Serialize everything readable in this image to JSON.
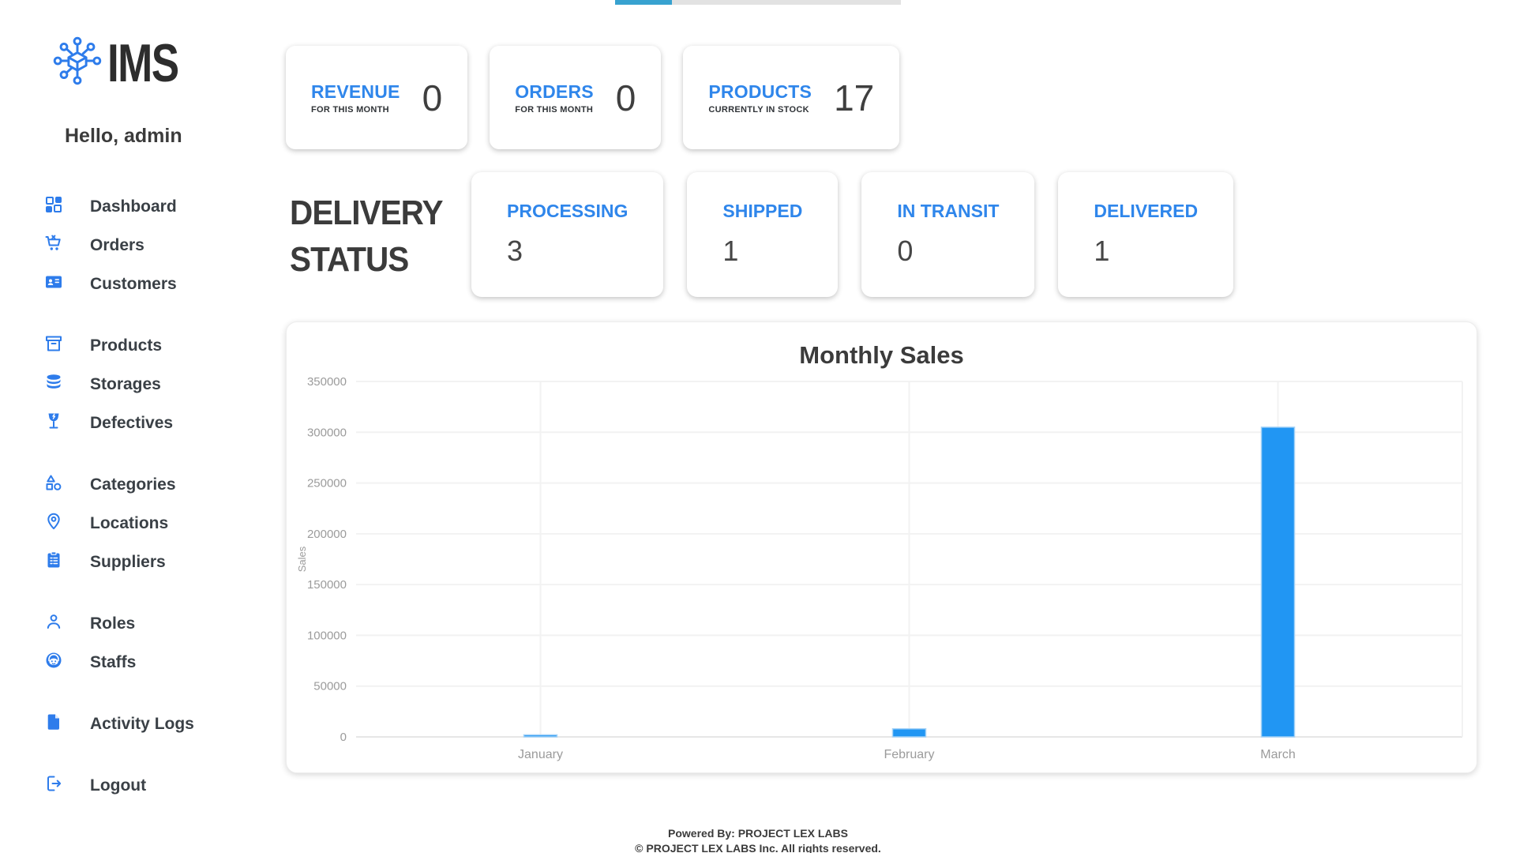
{
  "colors": {
    "accent_blue": "#2f86eb",
    "icon_blue": "#2e7ceb",
    "bar_blue": "#2196f3",
    "heading_dark": "#3b3b3b",
    "scrollbar_thumb": "#38a2d0"
  },
  "sidebar": {
    "logo_text": "IMS",
    "greeting": "Hello, admin",
    "items": [
      {
        "icon": "dashboard-icon",
        "label": "Dashboard"
      },
      {
        "icon": "cart-icon",
        "label": "Orders"
      },
      {
        "icon": "id-card-icon",
        "label": "Customers"
      },
      {
        "icon": "box-icon",
        "label": "Products"
      },
      {
        "icon": "database-icon",
        "label": "Storages"
      },
      {
        "icon": "broken-glass-icon",
        "label": "Defectives"
      },
      {
        "icon": "shapes-icon",
        "label": "Categories"
      },
      {
        "icon": "map-pin-icon",
        "label": "Locations"
      },
      {
        "icon": "clipboard-icon",
        "label": "Suppliers"
      },
      {
        "icon": "person-icon",
        "label": "Roles"
      },
      {
        "icon": "headset-person-icon",
        "label": "Staffs"
      },
      {
        "icon": "document-icon",
        "label": "Activity Logs"
      },
      {
        "icon": "logout-icon",
        "label": "Logout"
      }
    ]
  },
  "stats": [
    {
      "title": "REVENUE",
      "subtitle": "FOR THIS MONTH",
      "value": "0"
    },
    {
      "title": "ORDERS",
      "subtitle": "FOR THIS MONTH",
      "value": "0"
    },
    {
      "title": "PRODUCTS",
      "subtitle": "CURRENTLY IN STOCK",
      "value": "17"
    }
  ],
  "delivery": {
    "heading_line1": "DELIVERY",
    "heading_line2": "STATUS",
    "cards": [
      {
        "label": "PROCESSING",
        "value": "3"
      },
      {
        "label": "SHIPPED",
        "value": "1"
      },
      {
        "label": "IN TRANSIT",
        "value": "0"
      },
      {
        "label": "DELIVERED",
        "value": "1"
      }
    ]
  },
  "chart_data": {
    "type": "bar",
    "title": "Monthly Sales",
    "categories": [
      "January",
      "February",
      "March"
    ],
    "values": [
      2000,
      8000,
      305000
    ],
    "xlabel": "",
    "ylabel": "Sales",
    "ylim": [
      0,
      350000
    ],
    "yticks": [
      0,
      50000,
      100000,
      150000,
      200000,
      250000,
      300000,
      350000
    ],
    "grid": true,
    "legend": false,
    "bar_color": "#2196f3"
  },
  "footer": {
    "line1": "Powered By: PROJECT LEX LABS",
    "line2": "© PROJECT LEX LABS Inc. All rights reserved."
  }
}
